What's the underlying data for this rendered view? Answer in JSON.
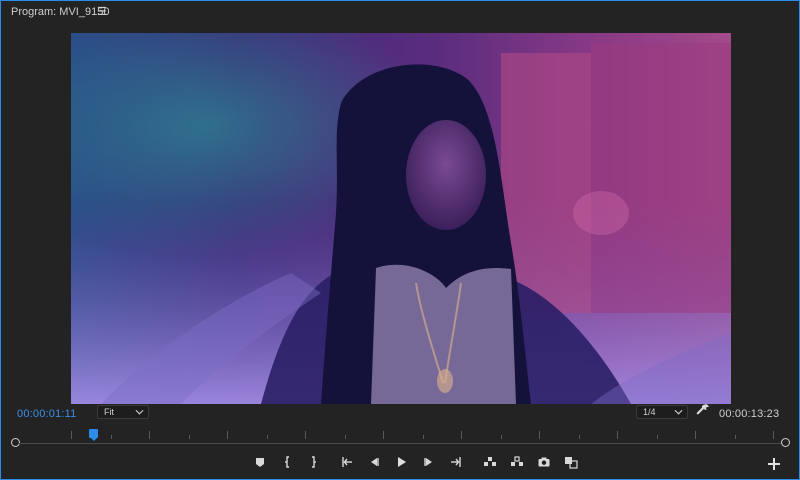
{
  "panel": {
    "title": "Program: MVI_9150",
    "menu_icon": "hamburger-icon"
  },
  "viewer": {
    "content": "video-frame"
  },
  "controls": {
    "current_timecode": "00:00:01:11",
    "fit_select_value": "Fit",
    "resolution_select_value": "1/4",
    "duration_timecode": "00:00:13:23",
    "wrench_icon": "wrench-icon"
  },
  "transport": {
    "buttons": [
      {
        "name": "add-marker-button",
        "icon": "marker-icon"
      },
      {
        "name": "mark-in-button",
        "icon": "mark-in-icon"
      },
      {
        "name": "mark-out-button",
        "icon": "mark-out-icon"
      },
      {
        "name": "go-to-in-button",
        "icon": "go-to-in-icon"
      },
      {
        "name": "step-back-button",
        "icon": "step-back-icon"
      },
      {
        "name": "play-button",
        "icon": "play-icon"
      },
      {
        "name": "step-forward-button",
        "icon": "step-forward-icon"
      },
      {
        "name": "go-to-out-button",
        "icon": "go-to-out-icon"
      },
      {
        "name": "lift-button",
        "icon": "lift-icon"
      },
      {
        "name": "extract-button",
        "icon": "extract-icon"
      },
      {
        "name": "export-frame-button",
        "icon": "camera-icon"
      },
      {
        "name": "compare-view-button",
        "icon": "compare-icon"
      }
    ],
    "add_button": "plus-icon"
  },
  "colors": {
    "accent": "#2d8ceb",
    "panel_bg": "#232323",
    "text": "#cfcfcf"
  },
  "playhead_position_fraction": 0.1
}
